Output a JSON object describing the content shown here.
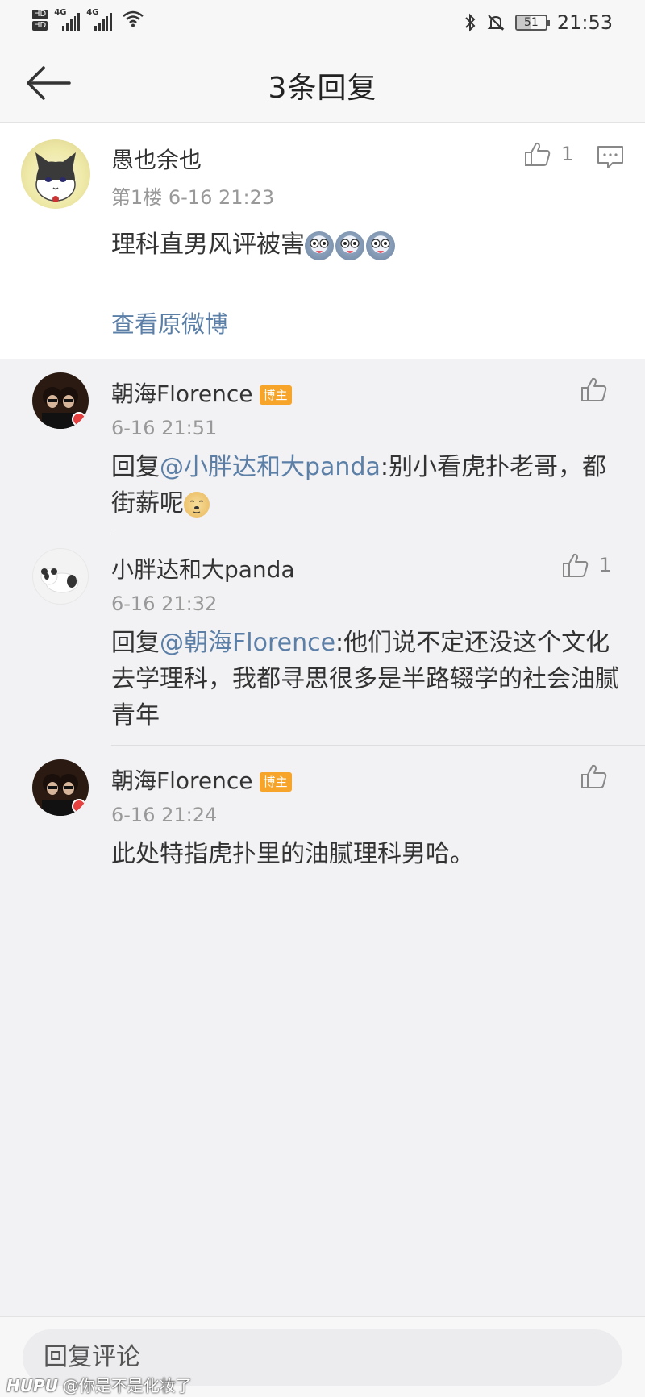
{
  "status_bar": {
    "hd1": "HD",
    "hd2": "HD",
    "net1": "4G",
    "net2": "4G",
    "battery": "51",
    "time": "21:53"
  },
  "header": {
    "title": "3条回复"
  },
  "main_comment": {
    "username": "愚也余也",
    "meta": "第1楼 6-16 21:23",
    "text": "理科直男风评被害",
    "likes": "1",
    "view_original": "查看原微博"
  },
  "replies": [
    {
      "username": "朝海Florence",
      "badge": "博主",
      "time": "6-16 21:51",
      "prefix": "回复",
      "mention": "@小胖达和大panda",
      "text": ":别小看虎扑老哥，都街薪呢",
      "likes": ""
    },
    {
      "username": "小胖达和大panda",
      "badge": "",
      "time": "6-16 21:32",
      "prefix": "回复",
      "mention": "@朝海Florence",
      "text": ":他们说不定还没这个文化去学理科，我都寻思很多是半路辍学的社会油腻青年",
      "likes": "1"
    },
    {
      "username": "朝海Florence",
      "badge": "博主",
      "time": "6-16 21:24",
      "prefix": "",
      "mention": "",
      "text": "此处特指虎扑里的油腻理科男哈。",
      "likes": ""
    }
  ],
  "bottom": {
    "reply_placeholder": "回复评论",
    "watermark_brand": "HUPU",
    "watermark_user": "@你是不是化妆了"
  },
  "colors": {
    "link": "#5b7fa6",
    "badge": "#f7a52a",
    "background": "#f2f2f4"
  }
}
